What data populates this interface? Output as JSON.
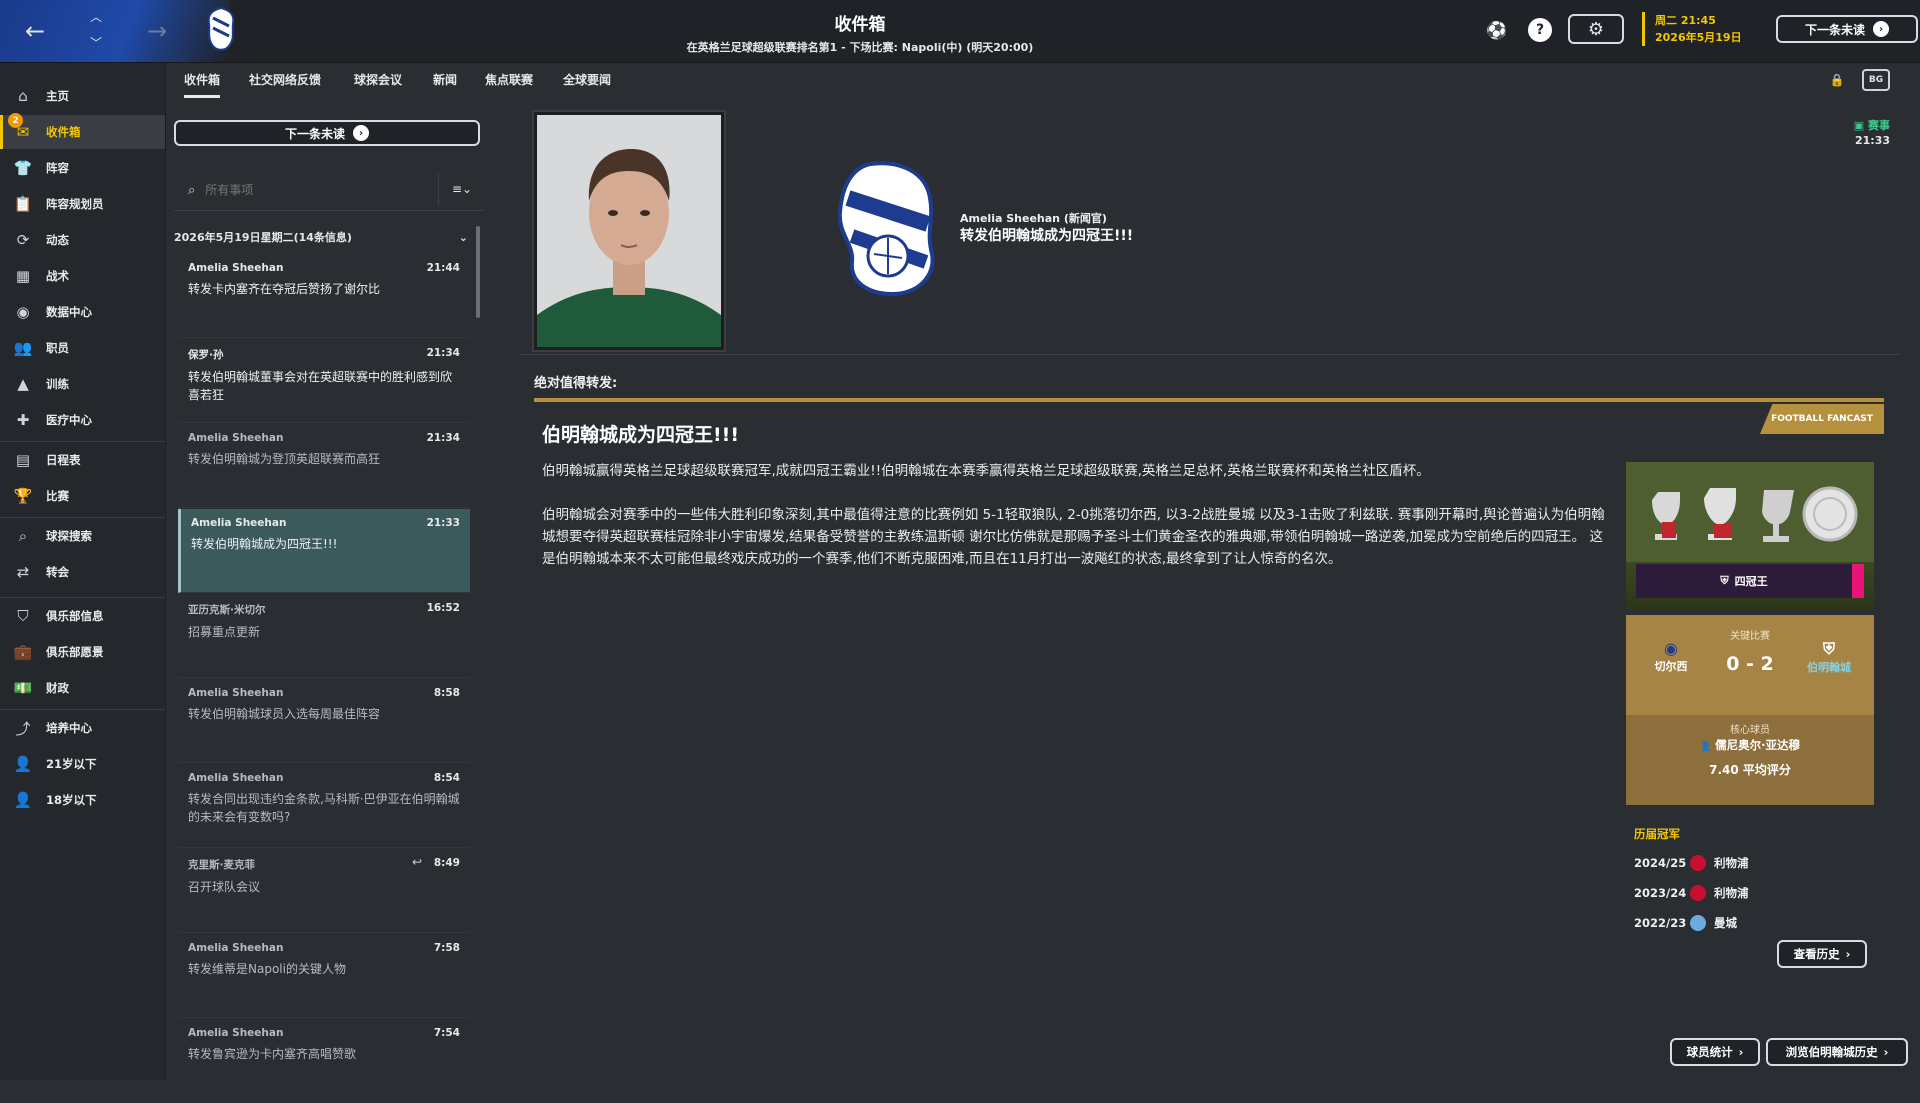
{
  "topbar": {
    "title": "收件箱",
    "subtitle": "在英格兰足球超级联赛排名第1 - 下场比赛: Napoli(中) (明天20:00)",
    "date_line1": "周二 21:45",
    "date_line2": "2026年5月19日",
    "next_unread": "下一条未读"
  },
  "sidebar": {
    "items": [
      {
        "label": "主页",
        "icon": "home-icon"
      },
      {
        "label": "收件箱",
        "icon": "inbox-icon",
        "badge": "2"
      },
      {
        "label": "阵容",
        "icon": "shirt-icon"
      },
      {
        "label": "阵容规划员",
        "icon": "clipboard-icon"
      },
      {
        "label": "动态",
        "icon": "dynamics-icon"
      },
      {
        "label": "战术",
        "icon": "tactics-icon"
      },
      {
        "label": "数据中心",
        "icon": "data-hub-icon"
      },
      {
        "label": "职员",
        "icon": "staff-icon"
      },
      {
        "label": "训练",
        "icon": "training-icon"
      },
      {
        "label": "医疗中心",
        "icon": "medical-icon"
      },
      {
        "label": "日程表",
        "icon": "calendar-icon"
      },
      {
        "label": "比赛",
        "icon": "trophy-icon"
      },
      {
        "label": "球探搜索",
        "icon": "search-icon"
      },
      {
        "label": "转会",
        "icon": "transfer-icon"
      },
      {
        "label": "俱乐部信息",
        "icon": "shield-icon"
      },
      {
        "label": "俱乐部愿景",
        "icon": "briefcase-icon"
      },
      {
        "label": "财政",
        "icon": "finance-icon"
      },
      {
        "label": "培养中心",
        "icon": "development-icon"
      },
      {
        "label": "21岁以下",
        "icon": "u21-icon"
      },
      {
        "label": "18岁以下",
        "icon": "u18-icon"
      }
    ]
  },
  "tabs": [
    "收件箱",
    "社交网络反馈",
    "球探会议",
    "新闻",
    "焦点联赛",
    "全球要闻"
  ],
  "inbox": {
    "next_unread": "下一条未读",
    "search_placeholder": "所有事项",
    "group_header": "2026年5月19日星期二(14条信息)",
    "messages": [
      {
        "from": "Amelia Sheehan",
        "time": "21:44",
        "subject": "转发卡内塞齐在夺冠后赞扬了谢尔比"
      },
      {
        "from": "保罗·孙",
        "time": "21:34",
        "subject": "转发伯明翰城董事会对在英超联赛中的胜利感到欣喜若狂"
      },
      {
        "from": "Amelia Sheehan",
        "time": "21:34",
        "subject": "转发伯明翰城为登顶英超联赛而高狂"
      },
      {
        "from": "Amelia Sheehan",
        "time": "21:33",
        "subject": "转发伯明翰城成为四冠王!!!"
      },
      {
        "from": "亚历克斯·米切尔",
        "time": "16:52",
        "subject": "招募重点更新"
      },
      {
        "from": "Amelia Sheehan",
        "time": "8:58",
        "subject": "转发伯明翰城球员入选每周最佳阵容"
      },
      {
        "from": "Amelia Sheehan",
        "time": "8:54",
        "subject": "转发合同出现违约金条款,马科斯·巴伊亚在伯明翰城的未来会有变数吗?"
      },
      {
        "from": "克里斯·麦克菲",
        "time": "8:49",
        "subject": "召开球队会议"
      },
      {
        "from": "Amelia Sheehan",
        "time": "7:58",
        "subject": "转发维蒂是Napoli的关键人物"
      },
      {
        "from": "Amelia Sheehan",
        "time": "7:54",
        "subject": "转发鲁宾逊为卡内塞齐高唱赞歌"
      }
    ]
  },
  "detail": {
    "tag": "赛事",
    "tag_time": "21:33",
    "sender": "Amelia Sheehan (新闻官)",
    "headline": "转发伯明翰城成为四冠王!!!",
    "club_crest_text": "BIRMINGHAM CITY FOOTBALL CLUB 1875",
    "worth_sharing": "绝对值得转发:",
    "source_tag": "FOOTBALL FANCAST",
    "article_title": "伯明翰城成为四冠王!!!",
    "article_p1": "伯明翰城赢得英格兰足球超级联赛冠军,成就四冠王霸业!!伯明翰城在本赛季赢得英格兰足球超级联赛,英格兰足总杯,英格兰联赛杯和英格兰社区盾杯。",
    "article_p2": "伯明翰城会对赛季中的一些伟大胜利印象深刻,其中最值得注意的比赛例如 5-1轻取狼队, 2-0挑落切尔西, 以3-2战胜曼城 以及3-1击败了利兹联. 赛事刚开幕时,舆论普遍认为伯明翰城想要夺得英超联赛桂冠除非小宇宙爆发,结果备受赞誉的主教练温斯顿 谢尔比仿佛就是那赐予圣斗士们黄金圣衣的雅典娜,带领伯明翰城一路逆袭,加冕成为空前绝后的四冠王。 这是伯明翰城本来不太可能但最终戏庆成功的一个赛季,他们不断克服困难,而且在11月打出一波飚红的状态,最终拿到了让人惊奇的名次。"
  },
  "card": {
    "trophy_label": "四冠王",
    "key_match_label": "关键比赛",
    "home_team": "切尔西",
    "away_team": "伯明翰城",
    "score": "0 - 2",
    "key_player_label": "核心球员",
    "key_player": "儒尼奥尔·亚达穆",
    "rating": "7.40 平均评分"
  },
  "champions": {
    "title": "历届冠军",
    "rows": [
      {
        "season": "2024/25",
        "club": "利物浦",
        "color": "#c8102e"
      },
      {
        "season": "2023/24",
        "club": "利物浦",
        "color": "#c8102e"
      },
      {
        "season": "2022/23",
        "club": "曼城",
        "color": "#6cabdd"
      }
    ],
    "history_button": "查看历史"
  },
  "footer": {
    "player_stats": "球员统计",
    "browse_history": "浏览伯明翰城历史"
  },
  "colors": {
    "accent": "#f4c600",
    "brand_blue": "#1f4aa8",
    "gold": "#b6913d",
    "active_row": "#3b5a5c"
  }
}
